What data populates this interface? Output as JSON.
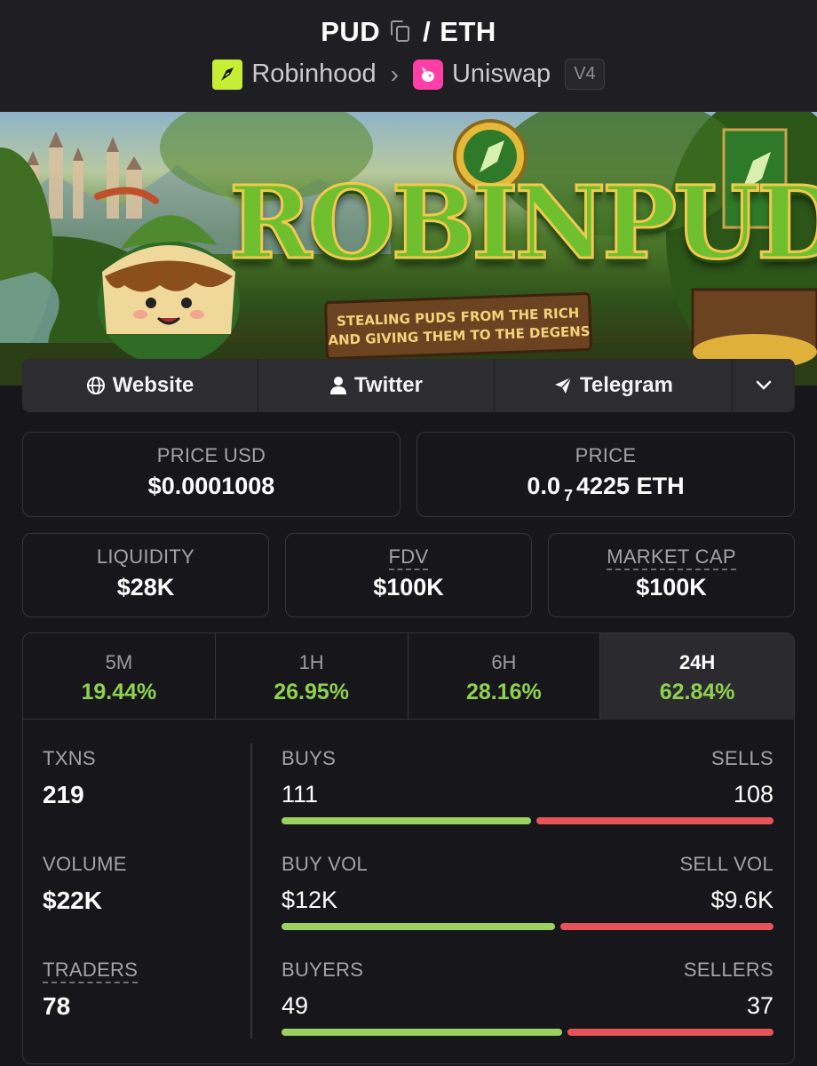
{
  "header": {
    "base": "PUD",
    "quote": "ETH",
    "separator": "/",
    "chain": "Robinhood",
    "dex": "Uniswap",
    "version": "V4"
  },
  "banner": {
    "title": "ROBINPUD",
    "tagline_1": "STEALING PUDS FROM THE RICH",
    "tagline_2": "AND GIVING THEM TO THE DEGENS"
  },
  "links": {
    "website": "Website",
    "twitter": "Twitter",
    "telegram": "Telegram"
  },
  "price_usd": {
    "label": "PRICE USD",
    "value": "$0.0001008"
  },
  "price_native": {
    "label": "PRICE",
    "prefix": "0.0",
    "zeros": "7",
    "digits": "4225",
    "unit": "ETH"
  },
  "liquidity": {
    "label": "LIQUIDITY",
    "value": "$28K"
  },
  "fdv": {
    "label": "FDV",
    "value": "$100K"
  },
  "market_cap": {
    "label": "MARKET CAP",
    "value": "$100K"
  },
  "timeframes": [
    {
      "label": "5M",
      "change": "19.44%"
    },
    {
      "label": "1H",
      "change": "26.95%"
    },
    {
      "label": "6H",
      "change": "28.16%"
    },
    {
      "label": "24H",
      "change": "62.84%",
      "active": true
    }
  ],
  "stats": {
    "txns": {
      "label": "TXNS",
      "value": "219"
    },
    "volume": {
      "label": "VOLUME",
      "value": "$22K"
    },
    "traders": {
      "label": "TRADERS",
      "value": "78"
    }
  },
  "breakdown": {
    "buys": {
      "label": "BUYS",
      "value": "111"
    },
    "sells": {
      "label": "SELLS",
      "value": "108"
    },
    "buy_vol": {
      "label": "BUY VOL",
      "value": "$12K"
    },
    "sell_vol": {
      "label": "SELL VOL",
      "value": "$9.6K"
    },
    "buyers": {
      "label": "BUYERS",
      "value": "49"
    },
    "sellers": {
      "label": "SELLERS",
      "value": "37"
    }
  },
  "bar_fractions": {
    "txns_buy": 0.507,
    "volume_buy": 0.556,
    "traders_buy": 0.57
  },
  "colors": {
    "positive": "#8fd14f",
    "buy_bar": "#9bd25f",
    "sell_bar": "#e8535a",
    "background": "#17171b"
  }
}
